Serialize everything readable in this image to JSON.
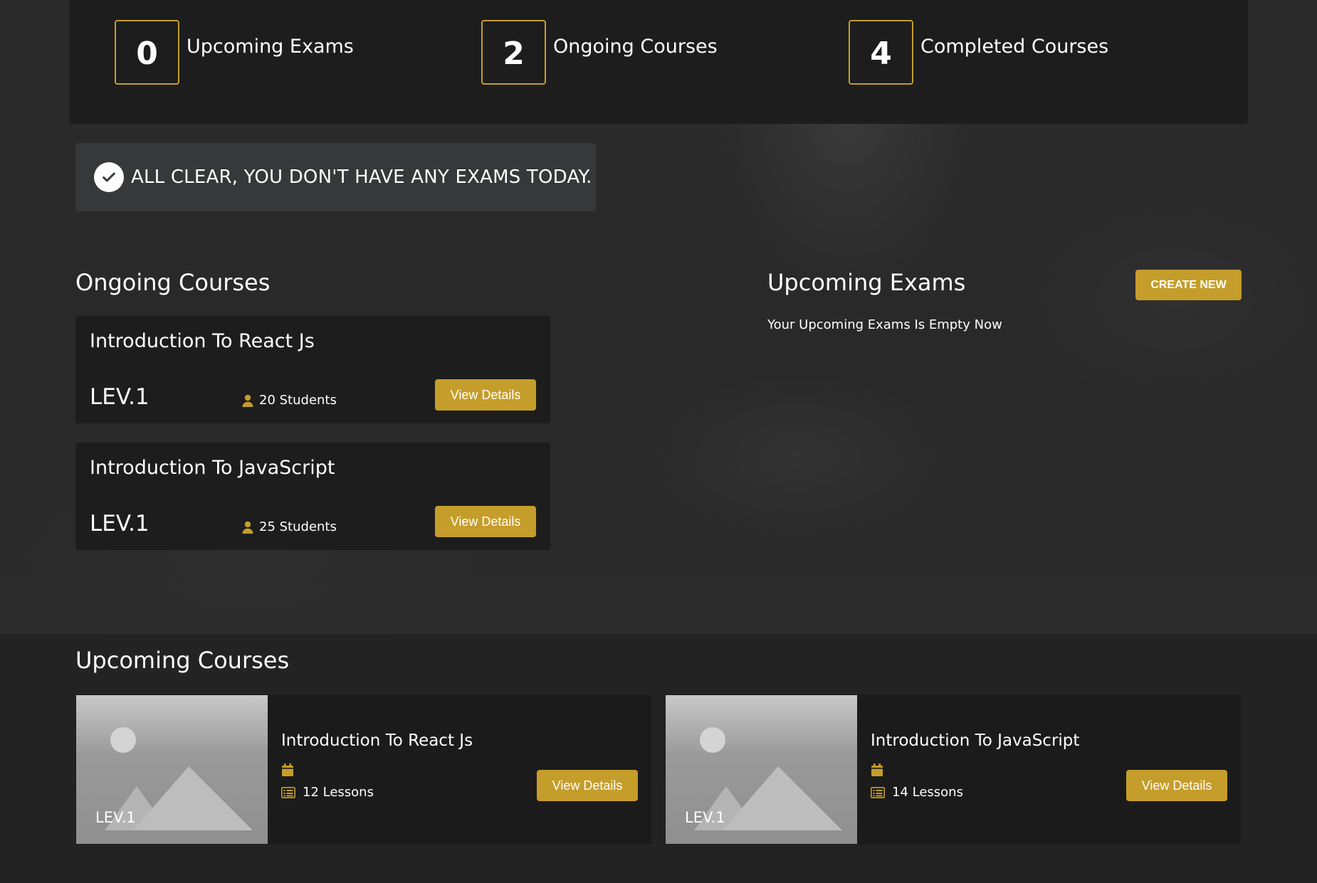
{
  "stats": [
    {
      "count": "0",
      "label": "Upcoming Exams"
    },
    {
      "count": "2",
      "label": "Ongoing Courses"
    },
    {
      "count": "4",
      "label": "Completed Courses"
    }
  ],
  "banner": {
    "text": "ALL CLEAR, YOU DON'T HAVE ANY EXAMS TODAY.",
    "icon": "check-circle-icon"
  },
  "ongoing": {
    "title": "Ongoing Courses",
    "courses": [
      {
        "title": "Introduction To React Js",
        "level": "LEV.1",
        "students": "20 Students",
        "button": "View Details"
      },
      {
        "title": "Introduction To JavaScript",
        "level": "LEV.1",
        "students": "25 Students",
        "button": "View Details"
      }
    ]
  },
  "exams": {
    "title": "Upcoming Exams",
    "create_label": "CREATE NEW",
    "empty_text": "Your Upcoming Exams Is Empty Now"
  },
  "upcoming": {
    "title": "Upcoming Courses",
    "courses": [
      {
        "title": "Introduction To React Js",
        "level": "LEV.1",
        "lessons": "12 Lessons",
        "button": "View Details"
      },
      {
        "title": "Introduction To JavaScript",
        "level": "LEV.1",
        "lessons": "14 Lessons",
        "button": "View Details"
      }
    ]
  },
  "colors": {
    "accent": "#c59d2a",
    "card": "#1d1d1d",
    "banner": "#37383a"
  }
}
